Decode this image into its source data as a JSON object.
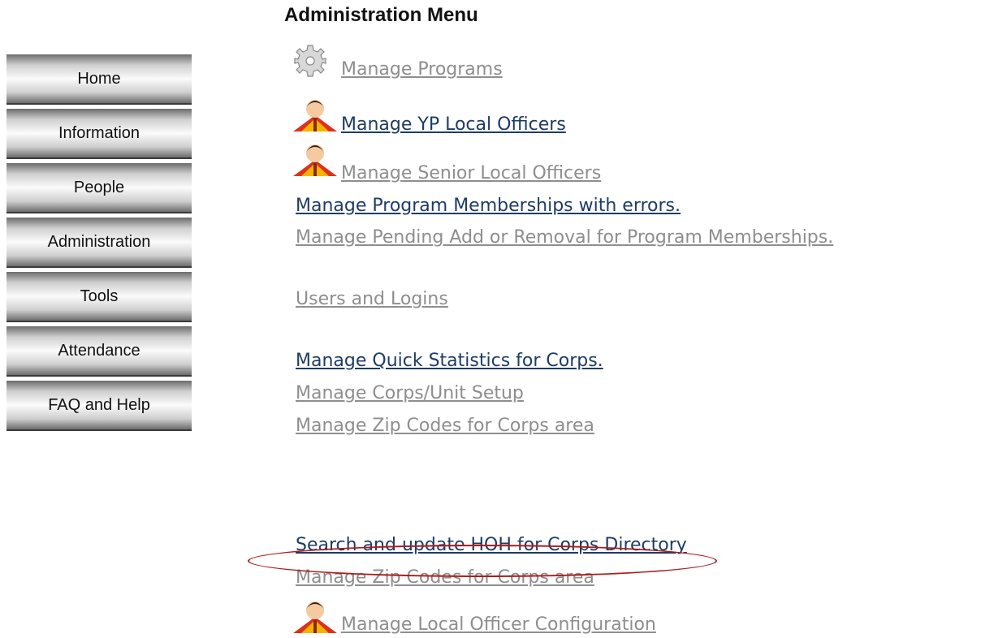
{
  "sidebar": {
    "items": [
      {
        "label": "Home"
      },
      {
        "label": "Information"
      },
      {
        "label": "People"
      },
      {
        "label": "Administration"
      },
      {
        "label": "Tools"
      },
      {
        "label": "Attendance"
      },
      {
        "label": "FAQ and Help"
      }
    ]
  },
  "main": {
    "title": "Administration Menu",
    "links": [
      {
        "label": "Manage Programs",
        "icon": "gear-icon"
      },
      {
        "label": "Manage YP Local Officers",
        "icon": "person-icon"
      },
      {
        "label": "Manage Senior Local Officers",
        "icon": "person-icon"
      },
      {
        "label": "Manage Program Memberships with errors."
      },
      {
        "label": "Manage Pending Add or Removal for Program Memberships."
      },
      {
        "label": "Users and Logins"
      },
      {
        "label": "Manage Quick Statistics for Corps."
      },
      {
        "label": "Manage Corps/Unit Setup"
      },
      {
        "label": "Manage Zip Codes for Corps area"
      },
      {
        "label": "Search and update HOH for Corps Directory"
      },
      {
        "label": "Manage Zip Codes for Corps area"
      },
      {
        "label": "Manage Local Officer Configuration",
        "icon": "person-icon"
      }
    ]
  },
  "colors": {
    "link_active": "#1d3c66",
    "link_visited": "#8e8e8e",
    "annotation": "#b01a1a"
  }
}
